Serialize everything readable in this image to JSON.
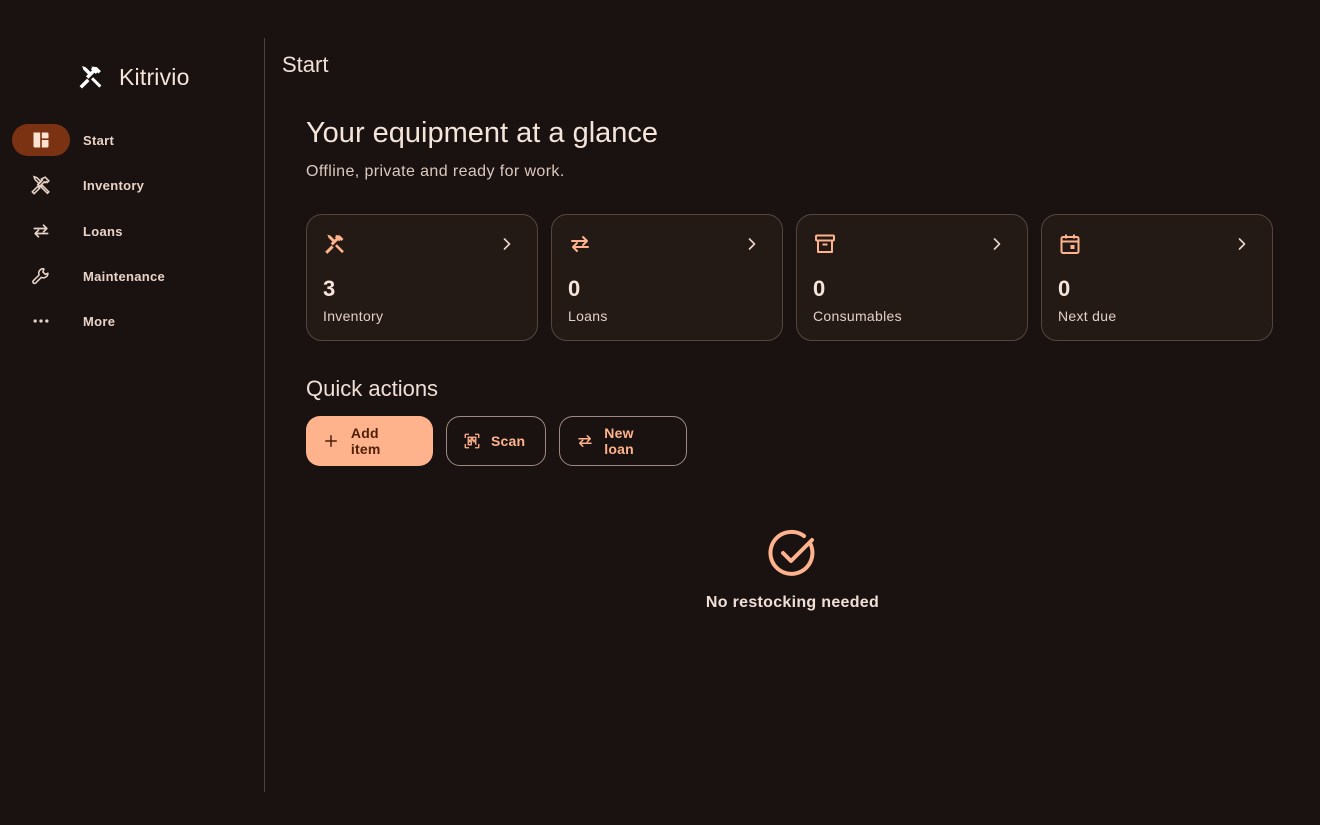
{
  "app": {
    "name": "Kitrivio",
    "logo_icon": "tools-icon"
  },
  "sidebar": {
    "items": [
      {
        "label": "Start",
        "icon": "dashboard-icon",
        "active": true
      },
      {
        "label": "Inventory",
        "icon": "tools-icon",
        "active": false
      },
      {
        "label": "Loans",
        "icon": "swap-icon",
        "active": false
      },
      {
        "label": "Maintenance",
        "icon": "wrench-icon",
        "active": false
      },
      {
        "label": "More",
        "icon": "more-horizontal-icon",
        "active": false
      }
    ]
  },
  "page": {
    "title": "Start",
    "headline": "Your equipment at a glance",
    "subline": "Offline, private and ready for work."
  },
  "cards": [
    {
      "value": "3",
      "label": "Inventory",
      "icon": "tools-icon"
    },
    {
      "value": "0",
      "label": "Loans",
      "icon": "swap-icon"
    },
    {
      "value": "0",
      "label": "Consumables",
      "icon": "archive-icon"
    },
    {
      "value": "0",
      "label": "Next due",
      "icon": "calendar-icon"
    }
  ],
  "quick_actions": {
    "title": "Quick actions",
    "add_item": "Add item",
    "scan": "Scan",
    "new_loan": "New loan"
  },
  "status": {
    "message": "No restocking needed",
    "icon": "check-circle-icon"
  },
  "colors": {
    "background": "#1a1210",
    "accent": "#ffb38d",
    "active_nav": "#7a3212"
  }
}
